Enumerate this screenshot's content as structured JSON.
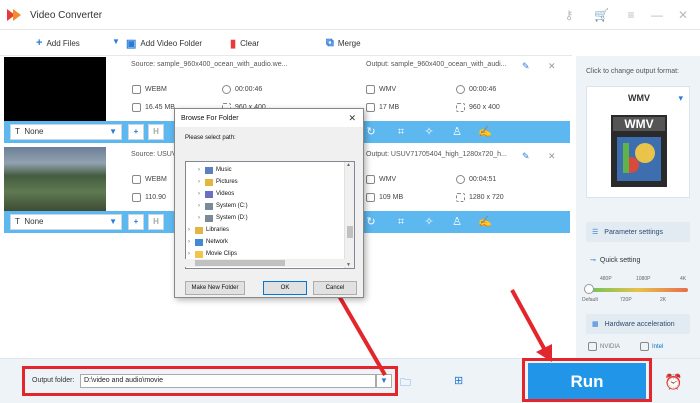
{
  "app": {
    "title": "Video Converter"
  },
  "toolbar": {
    "add_files": "Add Files",
    "add_video_folder": "Add Video Folder",
    "clear": "Clear",
    "merge": "Merge"
  },
  "files": [
    {
      "source": "Source: sample_960x400_ocean_with_audio.we...",
      "src_format": "WEBM",
      "src_duration": "00:00:46",
      "src_size": "16.45 MB",
      "src_resolution": "960 x 400",
      "output": "Output: sample_960x400_ocean_with_audi...",
      "out_format": "WMV",
      "out_duration": "00:00:46",
      "out_size": "17 MB",
      "out_resolution": "960 x 400",
      "subtitle": "None"
    },
    {
      "source": "Source: USUV",
      "src_format": "WEBM",
      "src_size": "110.90",
      "output": "Output: USUV71705404_high_1280x720_h...",
      "out_format": "WMV",
      "out_duration": "00:04:51",
      "out_size": "109 MB",
      "out_resolution": "1280 x 720",
      "subtitle": "None"
    }
  ],
  "panel": {
    "change_label": "Click to change output format:",
    "format": "WMV",
    "format_icon_text": "WMV",
    "parameter_settings": "Parameter settings",
    "quick_setting": "Quick setting",
    "ticks_top": [
      "480P",
      "1080P",
      "4K"
    ],
    "ticks_bottom": [
      "Default",
      "720P",
      "2K"
    ],
    "quality_level": 0,
    "hardware_acceleration": "Hardware acceleration",
    "gpu_nvidia": "NVIDIA",
    "gpu_intel": "Intel"
  },
  "dialog": {
    "title": "Browse For Folder",
    "prompt": "Please select path:",
    "tree": [
      {
        "label": "Music",
        "indent": 2
      },
      {
        "label": "Pictures",
        "indent": 2
      },
      {
        "label": "Videos",
        "indent": 2
      },
      {
        "label": "System (C:)",
        "indent": 2
      },
      {
        "label": "System (D:)",
        "indent": 2
      },
      {
        "label": "Libraries",
        "indent": 1
      },
      {
        "label": "Network",
        "indent": 1
      },
      {
        "label": "Movie Clips",
        "indent": 1
      }
    ],
    "make_new_folder": "Make New Folder",
    "ok": "OK",
    "cancel": "Cancel"
  },
  "bottom": {
    "output_folder_label": "Output folder:",
    "output_folder_value": "D:\\video and audio\\movie",
    "run": "Run"
  },
  "colors": {
    "accent": "#2196e8",
    "highlight": "#e3262b",
    "toolbar_blue": "#5db8f0"
  }
}
